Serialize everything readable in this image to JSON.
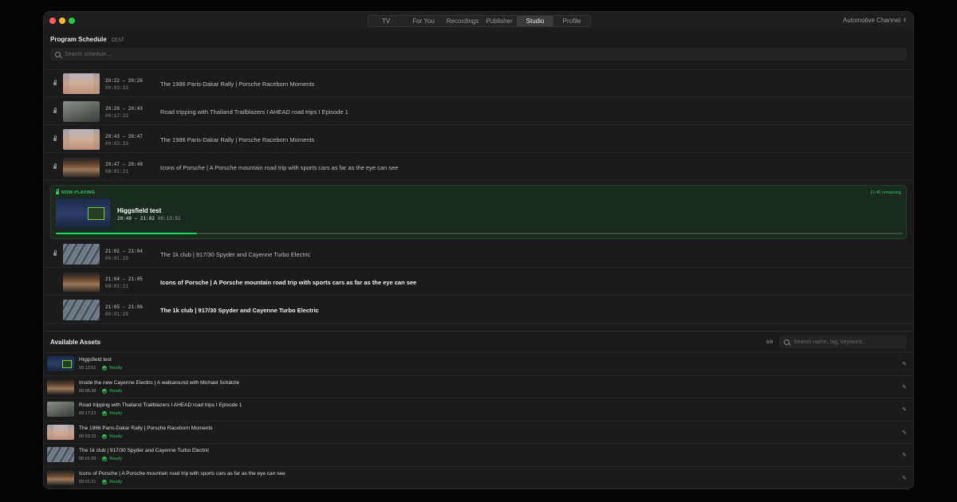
{
  "tabs": [
    {
      "label": "TV",
      "active": false
    },
    {
      "label": "For You",
      "active": false
    },
    {
      "label": "Recordings",
      "active": false
    },
    {
      "label": "Publisher",
      "active": false
    },
    {
      "label": "Studio",
      "active": true
    },
    {
      "label": "Profile",
      "active": false
    }
  ],
  "channel": {
    "label": "Automotive Channel",
    "icon": "chevron-updown-icon"
  },
  "schedule": {
    "title": "Program Schedule",
    "timezone": "CEST",
    "search_placeholder": "Search schedule...",
    "items_before": [
      {
        "time": "20:22 – 20:26",
        "duration": "00:03:33",
        "title": "The 1986 Paris-Dakar Rally | Porsche Raceborn Moments",
        "thumb": "desert",
        "locked": true
      },
      {
        "time": "20:26 – 20:43",
        "duration": "00:17:22",
        "title": "Road tripping with Thailand Trailblazers I AHEAD road trips I Episode 1",
        "thumb": "road",
        "locked": true
      },
      {
        "time": "20:43 – 20:47",
        "duration": "00:03:33",
        "title": "The 1986 Paris-Dakar Rally | Porsche Raceborn Moments",
        "thumb": "desert",
        "locked": true
      },
      {
        "time": "20:47 – 20:48",
        "duration": "00:01:21",
        "title": "Icons of Porsche | A Porsche mountain road trip with sports cars as far as the eye can see",
        "thumb": "car",
        "locked": true
      }
    ],
    "now_playing": {
      "label": "NOW PLAYING",
      "remaining": "11:40 remaining",
      "title": "Higgsfield test",
      "time": "20:48 – 21:02",
      "duration": "00:13:51",
      "progress": 0.167,
      "accent": "#22d55f"
    },
    "items_after": [
      {
        "time": "21:02 – 21:04",
        "duration": "00:01:29",
        "title": "The 1k club | 917/30 Spyder and Cayenne Turbo Electric",
        "thumb": "snow",
        "locked": true,
        "bright": false
      },
      {
        "time": "21:04 – 21:05",
        "duration": "00:01:21",
        "title": "Icons of Porsche | A Porsche mountain road trip with sports cars as far as the eye can see",
        "thumb": "car",
        "locked": false,
        "bright": true
      },
      {
        "time": "21:05 – 21:06",
        "duration": "00:01:29",
        "title": "The 1k club | 917/30 Spyder and Cayenne Turbo Electric",
        "thumb": "snow",
        "locked": false,
        "bright": true
      }
    ]
  },
  "assets": {
    "title": "Available Assets",
    "count": "6/6",
    "search_placeholder": "Search name, tag, keyword...",
    "items": [
      {
        "name": "Higgsfield test",
        "duration": "00:13:51",
        "status": "Ready",
        "thumb": "studio"
      },
      {
        "name": "Inside the new Cayenne Electric | A walkaround with Michael Schätzle",
        "duration": "00:06:38",
        "status": "Ready",
        "thumb": "car"
      },
      {
        "name": "Road tripping with Thailand Trailblazers I AHEAD road trips I Episode 1",
        "duration": "00:17:22",
        "status": "Ready",
        "thumb": "road"
      },
      {
        "name": "The 1986 Paris-Dakar Rally | Porsche Raceborn Moments",
        "duration": "00:03:33",
        "status": "Ready",
        "thumb": "desert"
      },
      {
        "name": "The 1k club | 917/30 Spyder and Cayenne Turbo Electric",
        "duration": "00:01:29",
        "status": "Ready",
        "thumb": "snow"
      },
      {
        "name": "Icons of Porsche | A Porsche mountain road trip with sports cars as far as the eye can see",
        "duration": "00:01:21",
        "status": "Ready",
        "thumb": "car"
      }
    ]
  }
}
